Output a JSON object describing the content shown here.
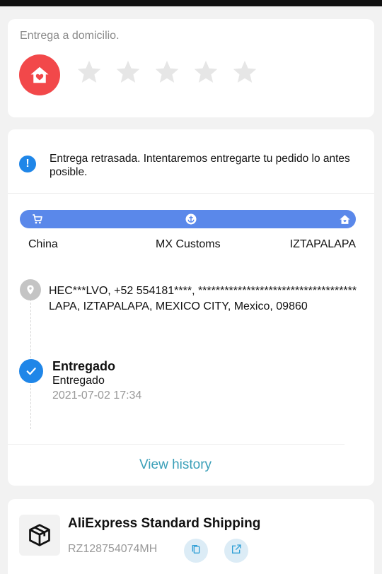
{
  "rating": {
    "label": "Entrega a domicilio.",
    "icon": "home-heart-icon",
    "stars": 5,
    "value": 0
  },
  "tracking": {
    "notice": "Entrega retrasada. Intentaremos entregarte tu pedido lo antes posible.",
    "stages": [
      {
        "label": "China",
        "icon": "cart-icon"
      },
      {
        "label": "MX Customs",
        "icon": "anchor-icon"
      },
      {
        "label": "IZTAPALAPA",
        "icon": "home-icon"
      }
    ],
    "address": "HEC***LVO,  +52 554181****,  ************************************LAPA,  IZTAPALAPA,  MEXICO CITY,  Mexico,  09860",
    "status": {
      "title": "Entregado",
      "subtitle": "Entregado",
      "time": "2021-07-02 17:34"
    },
    "view_history": "View history"
  },
  "shipping": {
    "method": "AliExpress Standard Shipping",
    "tracking_number": "RZ128754074MH"
  },
  "colors": {
    "accent_blue": "#1f86e8",
    "progress": "#5a88ea",
    "link": "#3a9fb8",
    "home_badge": "#f2484a"
  }
}
